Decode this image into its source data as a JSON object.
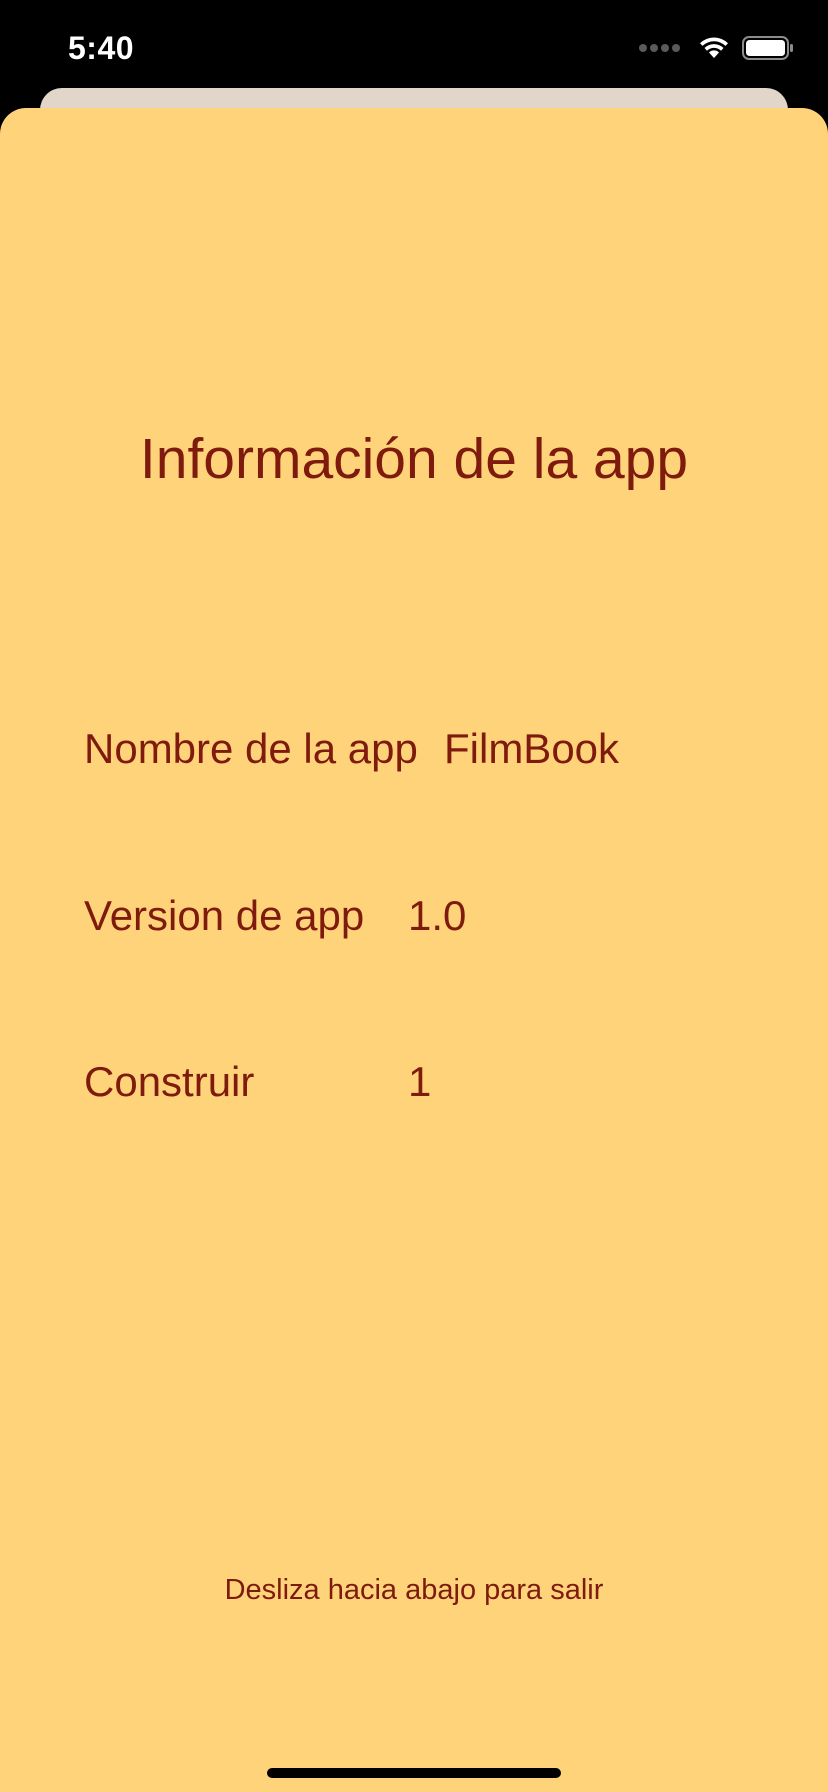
{
  "status_bar": {
    "time": "5:40",
    "icons": [
      "cellular-signal-icon",
      "wifi-icon",
      "battery-icon"
    ]
  },
  "sheet": {
    "title": "Información de la app",
    "rows": [
      {
        "label": "Nombre de la app",
        "value": "FilmBook"
      },
      {
        "label": "Version de app",
        "value": "1.0"
      },
      {
        "label": "Construir",
        "value": "1"
      }
    ],
    "footer_hint": "Desliza hacia abajo para salir"
  },
  "colors": {
    "background": "#ffd37a",
    "text": "#7f1a0e",
    "back_card": "#e2d5c9",
    "status_bar": "#000000"
  }
}
